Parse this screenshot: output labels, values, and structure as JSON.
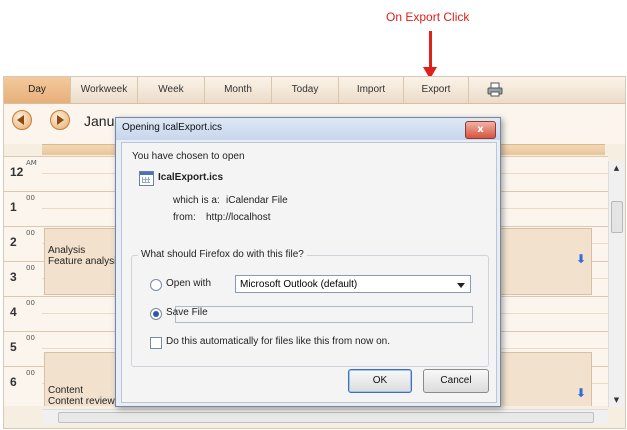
{
  "annotation": {
    "text": "On Export Click",
    "color": "#e0201b"
  },
  "toolbar": {
    "tabs": [
      {
        "label": "Day",
        "active": true
      },
      {
        "label": "Workweek"
      },
      {
        "label": "Week"
      },
      {
        "label": "Month"
      },
      {
        "label": "Today"
      },
      {
        "label": "Import"
      },
      {
        "label": "Export"
      }
    ],
    "print_icon": "printer-icon"
  },
  "nav": {
    "date_title": "Janua",
    "prev_icon": "arrow-left-icon",
    "next_icon": "arrow-right-icon"
  },
  "time_column": {
    "hours": [
      "12",
      "1",
      "2",
      "3",
      "4",
      "5",
      "6"
    ],
    "am_label": "AM",
    "minute_label": "00"
  },
  "appointments": [
    {
      "title": "Analysis",
      "subtitle": "Feature analysis"
    },
    {
      "title": "Content",
      "subtitle": "Content review"
    }
  ],
  "dialog": {
    "title": "Opening IcalExport.ics",
    "close_label": "x",
    "intro": "You have chosen to open",
    "filename": "IcalExport.ics",
    "which_is_label": "which is a:",
    "which_is_value": "iCalendar File",
    "from_label": "from:",
    "from_value": "http://localhost",
    "question": "What should Firefox do with this file?",
    "open_with_label": "Open with",
    "open_with_value": "Microsoft Outlook (default)",
    "save_file_label": "Save File",
    "selected_option": "save",
    "auto_label": "Do this automatically for files like this from now on.",
    "ok_label": "OK",
    "cancel_label": "Cancel"
  }
}
